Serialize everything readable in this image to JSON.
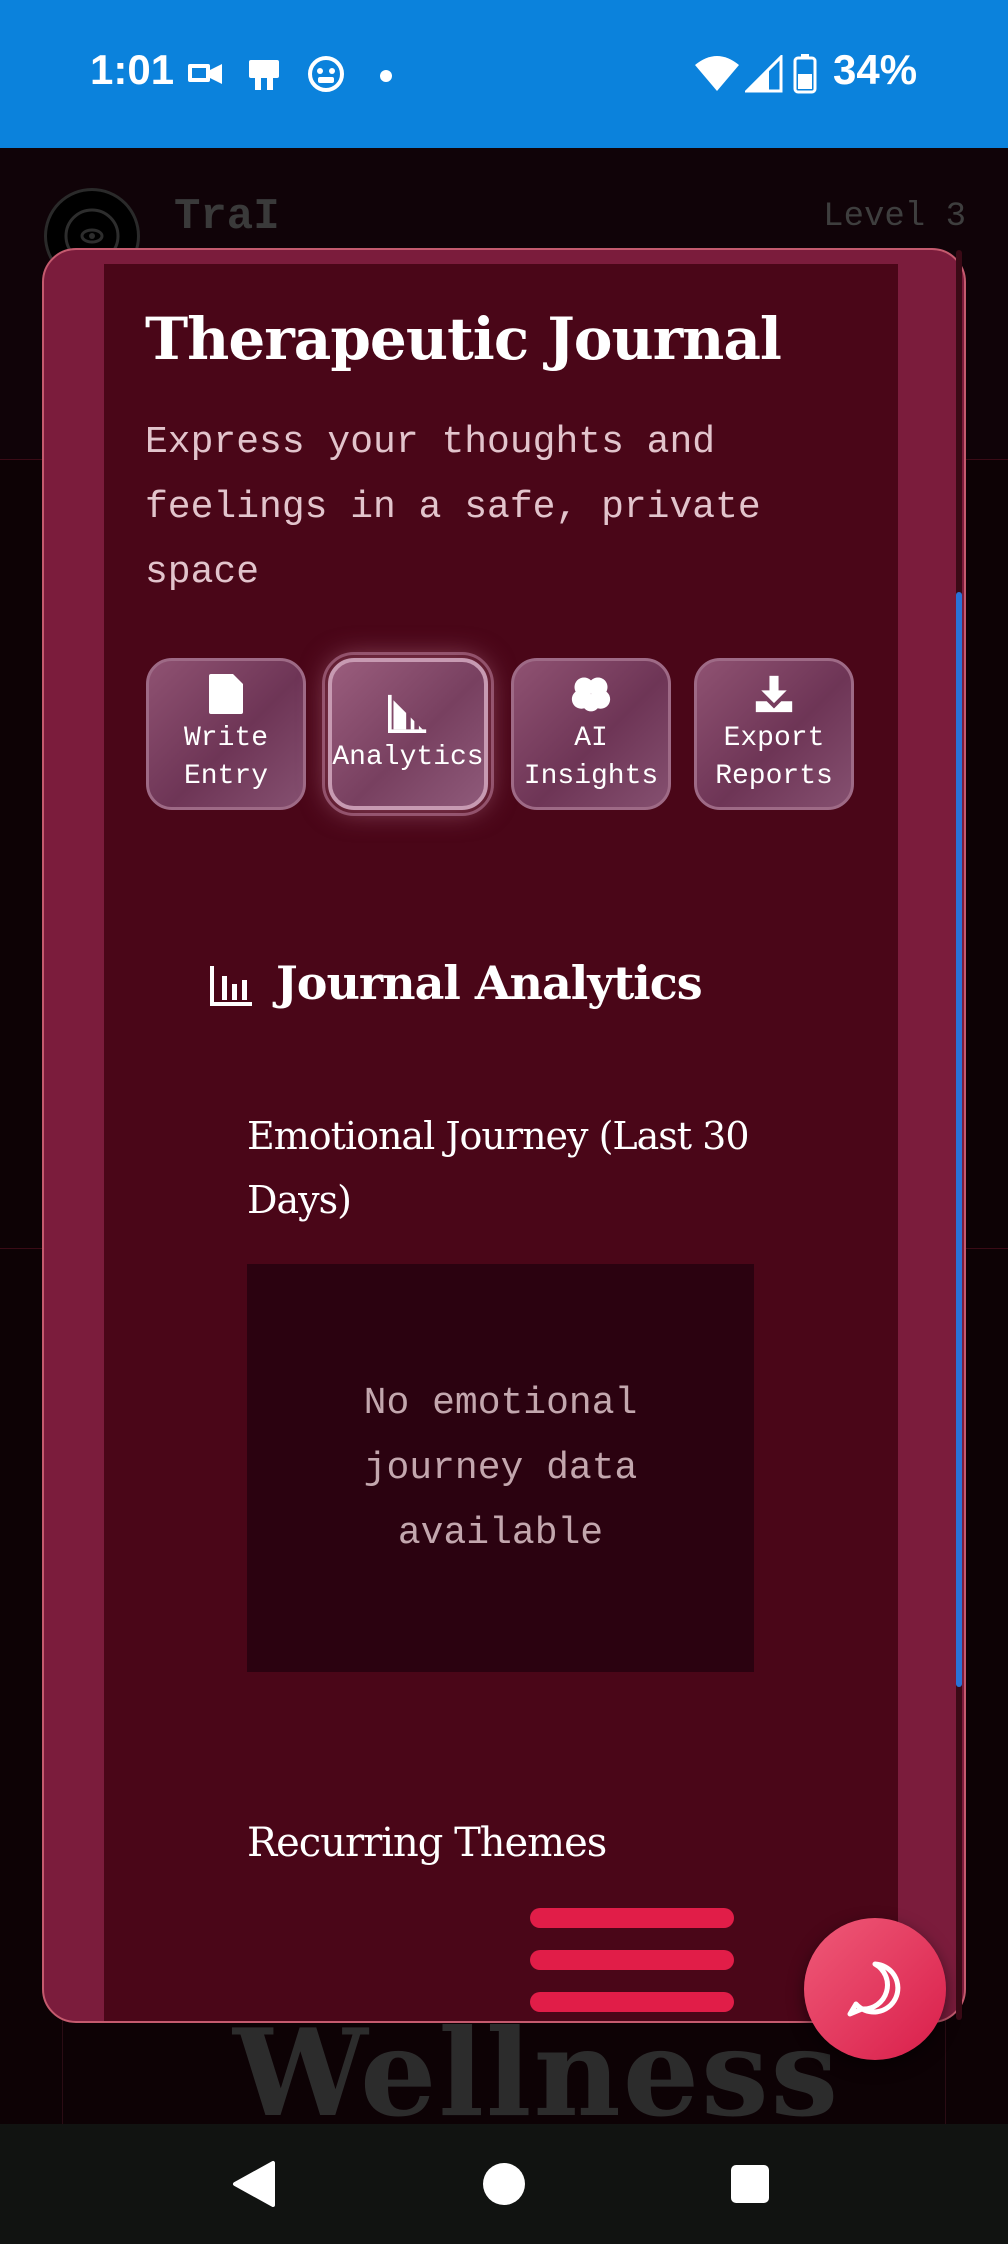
{
  "status_bar": {
    "time": "1:01",
    "battery": "34%",
    "background_color": "#0b82dc"
  },
  "background_app": {
    "title": "TraI",
    "level": "Level 3",
    "footer_card_text": "Wellness"
  },
  "modal": {
    "title": "Therapeutic Journal",
    "subtitle": "Express your thoughts and feelings in a safe, private space",
    "tabs": [
      {
        "label": "Write\nEntry",
        "icon": "document-icon",
        "active": false
      },
      {
        "label": "Analytics",
        "icon": "chart-icon",
        "active": true
      },
      {
        "label": "AI\nInsights",
        "icon": "brain-icon",
        "active": false
      },
      {
        "label": "Export\nReports",
        "icon": "download-icon",
        "active": false
      }
    ],
    "analytics": {
      "section_title": "Journal Analytics",
      "emotional_journey_title": "Emotional Journey (Last 30 Days)",
      "emotional_journey_empty": "No emotional journey data available",
      "recurring_themes_title": "Recurring Themes"
    }
  },
  "colors": {
    "modal_outer": "#7b1c3c",
    "modal_inner": "#4a0618",
    "accent": "#e11d48",
    "fab": "#e8405f"
  }
}
